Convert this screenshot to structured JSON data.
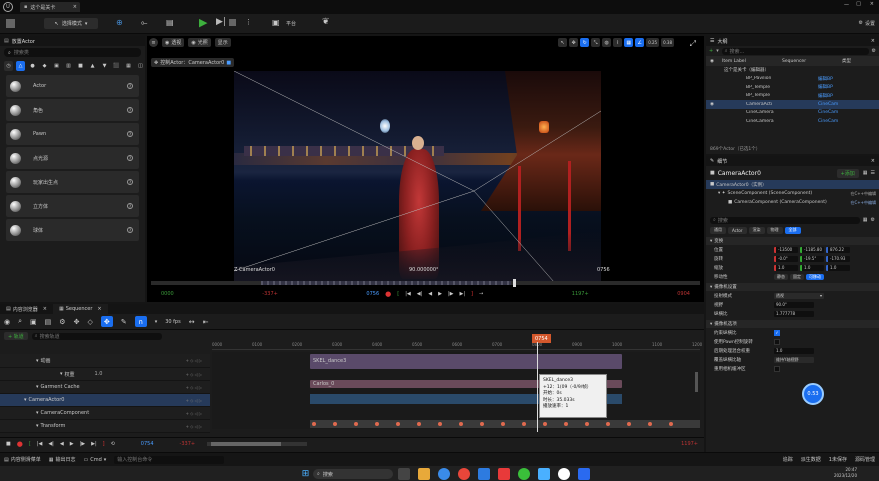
{
  "titlebar": {
    "tab_label": "这个是关卡"
  },
  "toolbar": {
    "mode_label": "选择模式",
    "platform_label": "平台",
    "settings_label": "设置"
  },
  "left_panel": {
    "title": "放置Actor",
    "search_placeholder": "搜索类",
    "items": [
      "Actor",
      "角色",
      "Pawn",
      "点光源",
      "玩家出生点",
      "立方体",
      "球体"
    ]
  },
  "viewport": {
    "perspective_label": "透视",
    "lit_label": "光照",
    "show_label": "显示",
    "pilot_label": "控制Actor：CameraActor0",
    "fov_left": "0.25",
    "fov_right": "0.38",
    "cam_name_label": "Z CameraActor0",
    "frame_label": "90.000000°",
    "frame_number": "0756",
    "tl_start": "0000",
    "tl_end": "1197+",
    "tl_left2": "-337+",
    "tl_right2": "0904",
    "tl_cur": "0756"
  },
  "outliner": {
    "title": "大纲",
    "search_placeholder": "搜索...",
    "col_label": "Item Label",
    "col_seq": "Sequencer",
    "col_type": "类型",
    "items": [
      {
        "label": "这个是关卡（编辑器）",
        "type": ""
      },
      {
        "label": "BP_Pavilion",
        "type": "编辑BP"
      },
      {
        "label": "BP_Temple",
        "type": "编辑BP"
      },
      {
        "label": "BP_Temple",
        "type": "编辑BP"
      },
      {
        "label": "CameraActi",
        "type": "CineCam"
      },
      {
        "label": "CineCamera",
        "type": "CineCam"
      },
      {
        "label": "CineCamera",
        "type": "CineCam"
      }
    ],
    "footer": "869个Actor（已选1个）"
  },
  "details": {
    "title": "细节",
    "actor_name": "CameraActor0",
    "add_label": "+添加",
    "component_root": "CameraActor0（实例）",
    "component_scene": "SceneComponent (SceneComponent)",
    "component_camera": "CameraComponent (CameraComponent)",
    "scene_right": "在C++中编辑",
    "camera_right": "在C++中编辑",
    "search_placeholder": "搜索",
    "tabs": [
      "通用",
      "Actor",
      "渲染",
      "物理",
      "全部"
    ],
    "section_transform": "变换",
    "loc_label": "位置",
    "rot_label": "旋转",
    "scale_label": "缩放",
    "loc": [
      "-13500",
      "-1185.80",
      "876.22"
    ],
    "rot": [
      "-0.0°",
      "-19.5°",
      "-170.93"
    ],
    "scale": [
      "1.0",
      "1.0",
      "1.0"
    ],
    "mobility_label": "移动性",
    "mobility_opts": [
      "静态",
      "固定",
      "可移动"
    ],
    "section_camera": "摄像机设置",
    "proj_label": "投射模式",
    "proj_value": "透视",
    "fov_label": "视野",
    "fov_value": "90.0°",
    "aspect_label": "纵横比",
    "aspect_value": "1.777778",
    "section_camopts": "摄像机选项",
    "ctrl1": "约束纵横比",
    "ctrl2": "使用Pawn控制旋转",
    "ctrl3": "后期处理混合权重",
    "ctrl3_value": "1.0",
    "ctrl4": "覆盖纵横比轴",
    "ctrl4_value": "维持Y轴视野",
    "ctrl5": "重用相机缓冲区",
    "badge": "0.53"
  },
  "sequencer": {
    "tab1": "内容浏览器",
    "tab2": "Sequencer",
    "fps": "30 fps",
    "add_label": "+ 轨道",
    "search_placeholder": "搜索轨道",
    "tracks": [
      {
        "label": "动画",
        "indent": 3
      },
      {
        "label": "权重",
        "indent": 5
      },
      {
        "label": "Garment Cache",
        "indent": 3
      },
      {
        "label": "CameraActor0",
        "indent": 2
      },
      {
        "label": "CameraComponent",
        "indent": 3
      },
      {
        "label": "Transform",
        "indent": 3
      }
    ],
    "weight_val": "1.0",
    "clip1": "SKEL_dance3",
    "clip2": "Carlos_0",
    "playhead": "0754",
    "ticks": [
      "0000",
      "0050",
      "0100",
      "0150",
      "0200",
      "0250",
      "0300",
      "0350",
      "0400",
      "0450",
      "0500",
      "0550",
      "0600",
      "0650",
      "0700",
      "0750",
      "0800",
      "0850",
      "0900",
      "0950",
      "1000",
      "1050",
      "1100",
      "1150",
      "1200"
    ],
    "tooltip": [
      "SKEL_dance3",
      "+12：1(09（-0/9/帧）",
      "开始：0s",
      "时长：35.033s",
      "播放速率：1"
    ],
    "frame_in": "0754",
    "range_start": "-337+",
    "range_end": "1197+"
  },
  "statusbar": {
    "content_drawer": "内容侧滑菜单",
    "output_log": "输出日志",
    "cmd": "Cmd",
    "cmd_placeholder": "输入控制台命令",
    "trace": "追踪",
    "derived": "派生数据",
    "save": "1未保存",
    "source": "源码管理"
  },
  "taskbar": {
    "search_placeholder": "搜索",
    "time": "20:47",
    "date": "2023/12/20"
  }
}
